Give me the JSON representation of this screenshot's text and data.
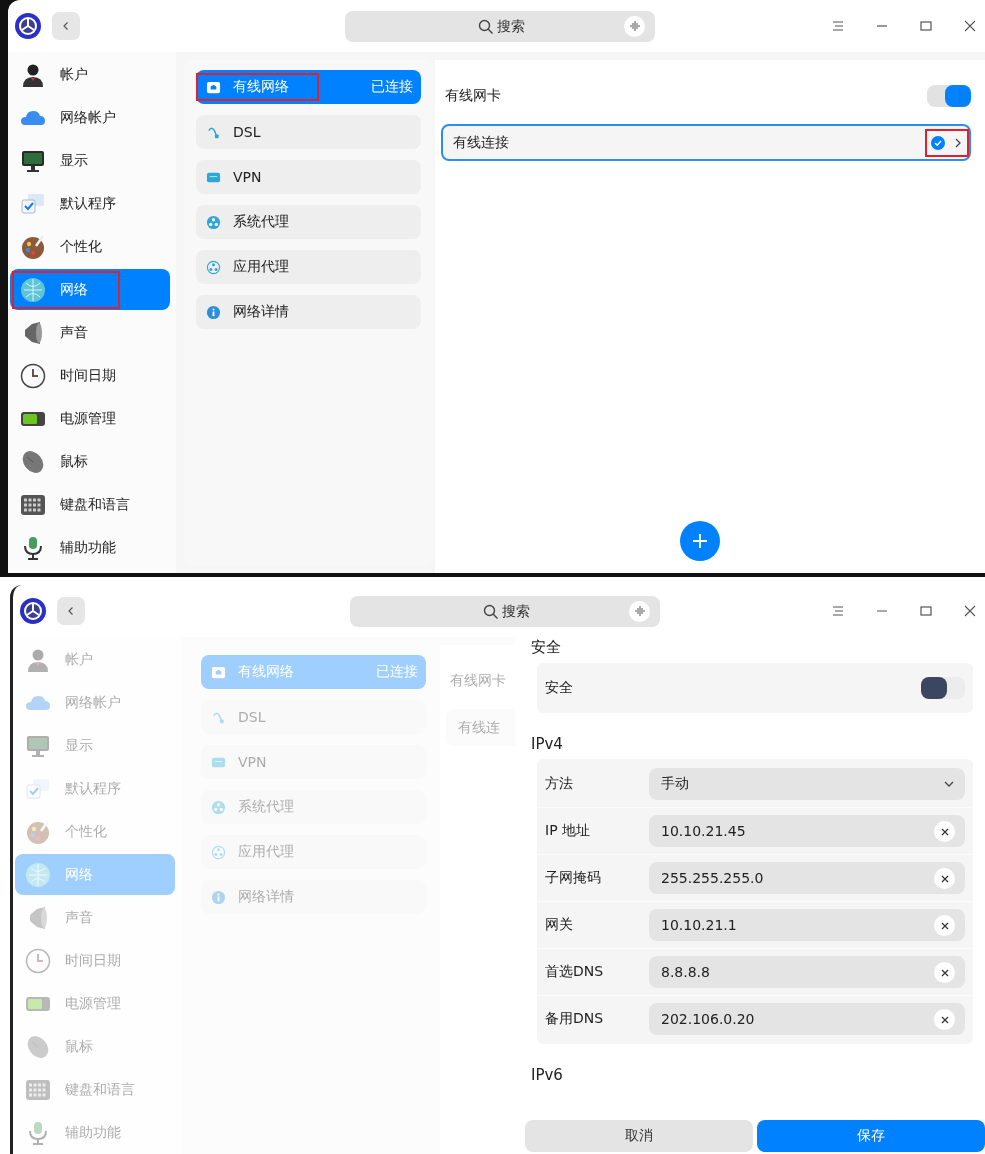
{
  "screens": [
    {
      "search": {
        "placeholder": "搜索"
      },
      "sidebar": [
        {
          "label": "帐户",
          "selected": false,
          "annotated": false
        },
        {
          "label": "网络帐户",
          "selected": false,
          "annotated": false
        },
        {
          "label": "显示",
          "selected": false,
          "annotated": false
        },
        {
          "label": "默认程序",
          "selected": false,
          "annotated": false
        },
        {
          "label": "个性化",
          "selected": false,
          "annotated": false
        },
        {
          "label": "网络",
          "selected": true,
          "annotated": true
        },
        {
          "label": "声音",
          "selected": false,
          "annotated": false
        },
        {
          "label": "时间日期",
          "selected": false,
          "annotated": false
        },
        {
          "label": "电源管理",
          "selected": false,
          "annotated": false
        },
        {
          "label": "鼠标",
          "selected": false,
          "annotated": false
        },
        {
          "label": "键盘和语言",
          "selected": false,
          "annotated": false
        },
        {
          "label": "辅助功能",
          "selected": false,
          "annotated": false
        }
      ],
      "network_menu": [
        {
          "label": "有线网络",
          "status": "已连接",
          "selected": true,
          "annotated": true
        },
        {
          "label": "DSL",
          "selected": false,
          "annotated": false
        },
        {
          "label": "VPN",
          "selected": false,
          "annotated": false
        },
        {
          "label": "系统代理",
          "selected": false,
          "annotated": false
        },
        {
          "label": "应用代理",
          "selected": false,
          "annotated": false
        },
        {
          "label": "网络详情",
          "selected": false,
          "annotated": false
        }
      ],
      "wired": {
        "title": "有线网卡",
        "enabled": true,
        "connections": [
          {
            "name": "有线连接",
            "active": true,
            "annotated": true
          }
        ],
        "add_button": true
      }
    },
    {
      "dimmed": true,
      "search": {
        "placeholder": "搜索"
      },
      "sidebar": [
        {
          "label": "帐户",
          "selected": false,
          "annotated": false
        },
        {
          "label": "网络帐户",
          "selected": false,
          "annotated": false
        },
        {
          "label": "显示",
          "selected": false,
          "annotated": false
        },
        {
          "label": "默认程序",
          "selected": false,
          "annotated": false
        },
        {
          "label": "个性化",
          "selected": false,
          "annotated": false
        },
        {
          "label": "网络",
          "selected": true,
          "annotated": false
        },
        {
          "label": "声音",
          "selected": false,
          "annotated": false
        },
        {
          "label": "时间日期",
          "selected": false,
          "annotated": false
        },
        {
          "label": "电源管理",
          "selected": false,
          "annotated": false
        },
        {
          "label": "鼠标",
          "selected": false,
          "annotated": false
        },
        {
          "label": "键盘和语言",
          "selected": false,
          "annotated": false
        },
        {
          "label": "辅助功能",
          "selected": false,
          "annotated": false
        }
      ],
      "network_menu": [
        {
          "label": "有线网络",
          "status": "已连接",
          "selected": true,
          "annotated": false
        },
        {
          "label": "DSL",
          "selected": false,
          "annotated": false
        },
        {
          "label": "VPN",
          "selected": false,
          "annotated": false
        },
        {
          "label": "系统代理",
          "selected": false,
          "annotated": false
        },
        {
          "label": "应用代理",
          "selected": false,
          "annotated": false
        },
        {
          "label": "网络详情",
          "selected": false,
          "annotated": false
        }
      ],
      "wired": {
        "title": "有线网卡",
        "connections": [
          {
            "name": "有线连"
          }
        ]
      },
      "settings_panel": {
        "sections": [
          {
            "title": "安全",
            "rows": [
              {
                "kind": "switch",
                "label": "安全",
                "on": false
              }
            ]
          },
          {
            "title": "IPv4",
            "rows": [
              {
                "kind": "select",
                "label": "方法",
                "value": "手动"
              },
              {
                "kind": "text",
                "label": "IP 地址",
                "value": "10.10.21.45"
              },
              {
                "kind": "text",
                "label": "子网掩码",
                "value": "255.255.255.0"
              },
              {
                "kind": "text",
                "label": "网关",
                "value": "10.10.21.1"
              },
              {
                "kind": "text",
                "label": "首选DNS",
                "value": "8.8.8.8"
              },
              {
                "kind": "text",
                "label": "备用DNS",
                "value": "202.106.0.20"
              }
            ]
          },
          {
            "title": "IPv6"
          }
        ],
        "buttons": [
          {
            "label": "取消",
            "kind": "secondary"
          },
          {
            "label": "保存",
            "kind": "primary"
          }
        ]
      }
    }
  ]
}
